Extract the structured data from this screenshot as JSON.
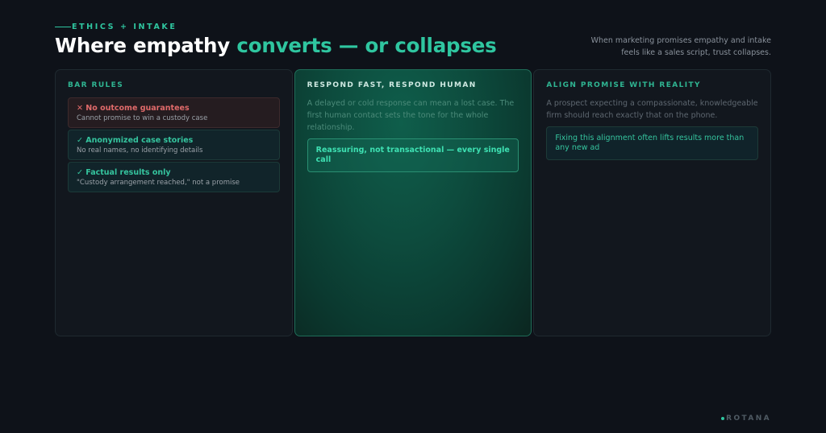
{
  "header": {
    "eyebrow": "ETHICS + INTAKE",
    "title_main": "Where empathy ",
    "title_accent": "converts — or collapses",
    "lede": "When marketing promises empathy and intake feels like a sales script, trust collapses."
  },
  "columns": [
    {
      "title": "BAR RULES",
      "rules": [
        {
          "kind": "bad",
          "mark": "✕",
          "head": "No outcome guarantees",
          "sub": "Cannot promise to win a custody case"
        },
        {
          "kind": "good",
          "mark": "✓",
          "head": "Anonymized case stories",
          "sub": "No real names, no identifying details"
        },
        {
          "kind": "good",
          "mark": "✓",
          "head": "Factual results only",
          "sub": "\"Custody arrangement reached,\" not a promise"
        }
      ]
    },
    {
      "title": "RESPOND FAST, RESPOND HUMAN",
      "body": "A delayed or cold response can mean a lost case. The first human contact sets the tone for the whole relationship.",
      "callout": "Reassuring, not transactional — every single call"
    },
    {
      "title": "ALIGN PROMISE WITH REALITY",
      "body": "A prospect expecting a compassionate, knowledgeable firm should reach exactly that on the phone.",
      "callout": "Fixing this alignment often lifts results more than any new ad"
    }
  ],
  "brand": {
    "name": "ROTANA"
  },
  "colors": {
    "background": "#0e1219",
    "accent": "#2fc6a0",
    "danger": "#e06a6a",
    "featured_card": "#0d4b3d"
  }
}
